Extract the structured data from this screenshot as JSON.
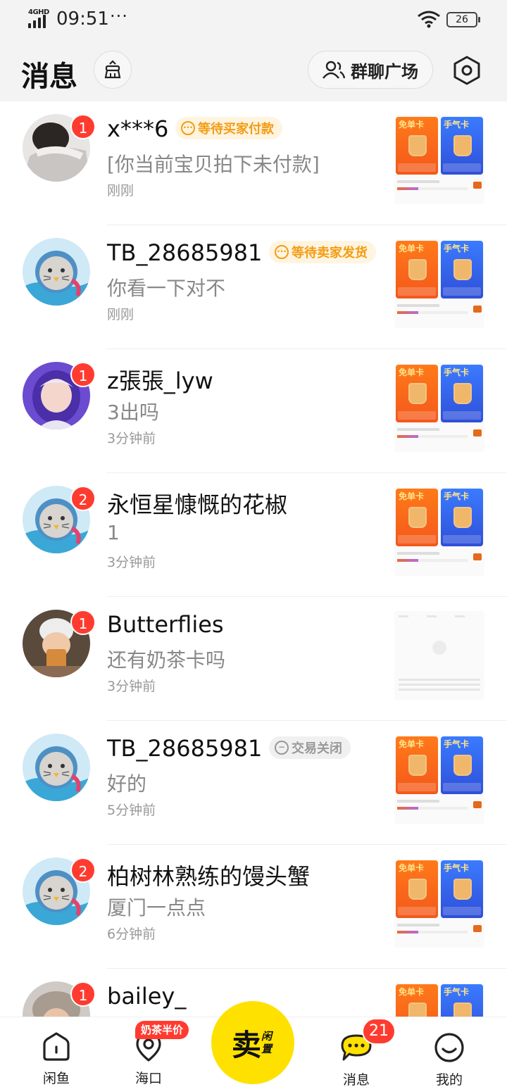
{
  "status_bar": {
    "network": "4GHD",
    "time": "09:51",
    "overflow": "···",
    "battery": "26"
  },
  "header": {
    "title": "消息",
    "group_square_label": "群聊广场",
    "icons": {
      "clean": "broom-icon",
      "group": "people-icon",
      "settings": "hexagon-settings-icon"
    }
  },
  "conversations": [
    {
      "name": "x***6",
      "tag": "等待买家付款",
      "tag_type": "warn",
      "preview": "[你当前宝贝拍下未付款]",
      "time": "刚刚",
      "badge": "1",
      "avatar": "photo-arm"
    },
    {
      "name": "TB_28685981",
      "tag": "等待卖家发货",
      "tag_type": "warn",
      "preview": "你看一下对不",
      "time": "刚刚",
      "badge": "",
      "avatar": "default-seal"
    },
    {
      "name": "z張張_lyw",
      "tag": "",
      "tag_type": "",
      "preview": "3出吗",
      "time": "3分钟前",
      "badge": "1",
      "avatar": "photo-purple-hood"
    },
    {
      "name": "永恒星慷慨的花椒",
      "tag": "",
      "tag_type": "",
      "preview": "1",
      "time": "3分钟前",
      "badge": "2",
      "avatar": "default-seal"
    },
    {
      "name": "Butterflies",
      "tag": "",
      "tag_type": "",
      "preview": "还有奶茶卡吗",
      "time": "3分钟前",
      "badge": "1",
      "avatar": "photo-drink"
    },
    {
      "name": "TB_28685981",
      "tag": "交易关闭",
      "tag_type": "closed",
      "preview": "好的",
      "time": "5分钟前",
      "badge": "",
      "avatar": "default-seal"
    },
    {
      "name": "柏树林熟练的馒头蟹",
      "tag": "",
      "tag_type": "",
      "preview": "厦门一点点",
      "time": "6分钟前",
      "badge": "2",
      "avatar": "default-seal"
    },
    {
      "name": "bailey_",
      "tag": "",
      "tag_type": "",
      "preview": "",
      "time": "",
      "badge": "1",
      "avatar": "photo-hat"
    }
  ],
  "thumbnail": {
    "card_left": "免单卡",
    "card_right": "手气卡"
  },
  "nav": {
    "items": [
      {
        "label": "闲鱼",
        "icon": "home-icon"
      },
      {
        "label": "海口",
        "icon": "location-icon"
      },
      {
        "label": "消息",
        "icon": "chat-icon"
      },
      {
        "label": "我的",
        "icon": "smile-icon"
      }
    ],
    "promo": "奶茶半价",
    "sell_big": "卖",
    "sell_small": "闲置",
    "message_badge": "21"
  },
  "colors": {
    "badge": "#ff3b30",
    "sell": "#ffe100",
    "tag_warn": "#f39c12",
    "header_bg": "#f3f3f3"
  }
}
